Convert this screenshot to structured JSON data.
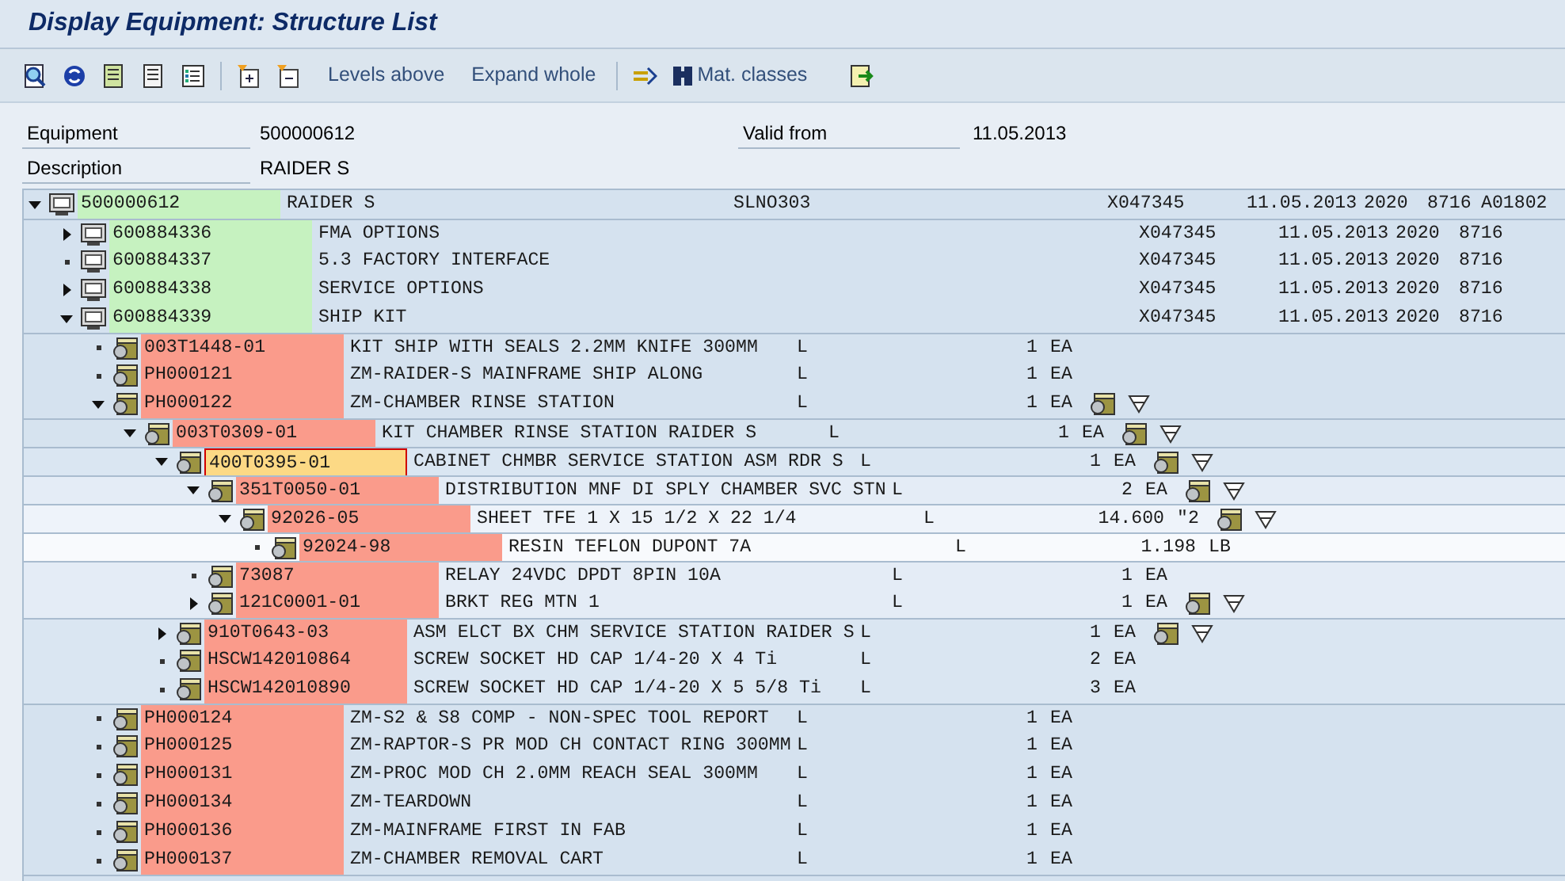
{
  "window": {
    "title": "Display Equipment: Structure List"
  },
  "toolbar": {
    "buttons": [
      "Levels above",
      "Expand whole",
      "Mat. classes"
    ]
  },
  "header": {
    "fields": [
      {
        "label": "Equipment",
        "value": "500000612"
      },
      {
        "label": "Valid from",
        "value": "11.05.2013"
      },
      {
        "label": "Description",
        "value": "RAIDER S"
      }
    ]
  },
  "tree": {
    "nodes": [
      {
        "kind": "equipment",
        "number": "500000612",
        "description": "RAIDER S",
        "expanded": true,
        "leaf": false,
        "selected": false,
        "column_3": "SLNO303",
        "column_4": "X047345",
        "column_5": "11.05.2013",
        "column_6": "2020",
        "column_7": "8716",
        "column_8": "A01802",
        "children": [
          {
            "kind": "equipment",
            "number": "600884336",
            "description": "FMA OPTIONS",
            "expanded": false,
            "leaf": false,
            "selected": false,
            "column_4": "X047345",
            "column_5": "11.05.2013",
            "column_6": "2020",
            "column_7": "8716"
          },
          {
            "kind": "equipment",
            "number": "600884337",
            "description": "5.3 FACTORY INTERFACE",
            "expanded": false,
            "leaf": true,
            "selected": false,
            "column_4": "X047345",
            "column_5": "11.05.2013",
            "column_6": "2020",
            "column_7": "8716"
          },
          {
            "kind": "equipment",
            "number": "600884338",
            "description": "SERVICE OPTIONS",
            "expanded": false,
            "leaf": false,
            "selected": false,
            "column_4": "X047345",
            "column_5": "11.05.2013",
            "column_6": "2020",
            "column_7": "8716"
          },
          {
            "kind": "equipment",
            "number": "600884339",
            "description": "SHIP KIT",
            "expanded": true,
            "leaf": false,
            "selected": false,
            "column_4": "X047345",
            "column_5": "11.05.2013",
            "column_6": "2020",
            "column_7": "8716",
            "children": [
              {
                "kind": "material",
                "number": "003T1448-01",
                "description": "KIT SHIP WITH SEALS 2.2MM KNIFE 300MM",
                "expanded": false,
                "leaf": true,
                "selected": false,
                "column_3": "L",
                "quantity": "1",
                "unit": "EA",
                "links_shown": false
              },
              {
                "kind": "material",
                "number": "PH000121",
                "description": "ZM-RAIDER-S MAINFRAME SHIP ALONG",
                "expanded": false,
                "leaf": true,
                "selected": false,
                "column_3": "L",
                "quantity": "1",
                "unit": "EA",
                "links_shown": false
              },
              {
                "kind": "material",
                "number": "PH000122",
                "description": "ZM-CHAMBER RINSE STATION",
                "expanded": true,
                "leaf": false,
                "selected": false,
                "column_3": "L",
                "quantity": "1",
                "unit": "EA",
                "links_shown": true,
                "children": [
                  {
                    "kind": "material",
                    "number": "003T0309-01",
                    "description": "KIT CHAMBER RINSE STATION RAIDER S",
                    "expanded": true,
                    "leaf": false,
                    "selected": false,
                    "column_3": "L",
                    "quantity": "1",
                    "unit": "EA",
                    "links_shown": true,
                    "children": [
                      {
                        "kind": "material",
                        "number": "400T0395-01",
                        "description": "CABINET CHMBR SERVICE STATION ASM RDR S",
                        "expanded": true,
                        "leaf": false,
                        "selected": true,
                        "column_3": "L",
                        "quantity": "1",
                        "unit": "EA",
                        "links_shown": true,
                        "children": [
                          {
                            "kind": "material",
                            "number": "351T0050-01",
                            "description": "DISTRIBUTION MNF DI SPLY CHAMBER SVC STN",
                            "expanded": true,
                            "leaf": false,
                            "selected": false,
                            "column_3": "L",
                            "quantity": "2",
                            "unit": "EA",
                            "links_shown": true,
                            "children": [
                              {
                                "kind": "material",
                                "number": "92026-05",
                                "description": "SHEET TFE 1 X 15 1/2 X 22 1/4",
                                "expanded": true,
                                "leaf": false,
                                "selected": false,
                                "column_3": "L",
                                "quantity": "14.600",
                                "unit": "\"2",
                                "links_shown": true,
                                "children": [
                                  {
                                    "kind": "material",
                                    "number": "92024-98",
                                    "description": "RESIN TEFLON DUPONT 7A",
                                    "expanded": false,
                                    "leaf": true,
                                    "selected": false,
                                    "column_3": "L",
                                    "quantity": "1.198",
                                    "unit": "LB",
                                    "links_shown": false
                                  }
                                ]
                              }
                            ]
                          },
                          {
                            "kind": "material",
                            "number": "73087",
                            "description": "RELAY 24VDC DPDT 8PIN 10A",
                            "expanded": false,
                            "leaf": true,
                            "selected": false,
                            "column_3": "L",
                            "quantity": "1",
                            "unit": "EA",
                            "links_shown": false
                          },
                          {
                            "kind": "material",
                            "number": "121C0001-01",
                            "description": "BRKT REG MTN 1",
                            "expanded": false,
                            "leaf": false,
                            "selected": false,
                            "column_3": "L",
                            "quantity": "1",
                            "unit": "EA",
                            "links_shown": true
                          }
                        ]
                      },
                      {
                        "kind": "material",
                        "number": "910T0643-03",
                        "description": "ASM ELCT BX CHM SERVICE STATION RAIDER S",
                        "expanded": false,
                        "leaf": false,
                        "selected": false,
                        "column_3": "L",
                        "quantity": "1",
                        "unit": "EA",
                        "links_shown": true
                      },
                      {
                        "kind": "material",
                        "number": "HSCW142010864",
                        "description": "SCREW SOCKET HD CAP 1/4-20 X 4 Ti",
                        "expanded": false,
                        "leaf": true,
                        "selected": false,
                        "column_3": "L",
                        "quantity": "2",
                        "unit": "EA",
                        "links_shown": false
                      },
                      {
                        "kind": "material",
                        "number": "HSCW142010890",
                        "description": "SCREW SOCKET HD CAP 1/4-20 X 5 5/8 Ti",
                        "expanded": false,
                        "leaf": true,
                        "selected": false,
                        "column_3": "L",
                        "quantity": "3",
                        "unit": "EA",
                        "links_shown": false
                      }
                    ]
                  }
                ]
              },
              {
                "kind": "material",
                "number": "PH000124",
                "description": "ZM-S2 & S8 COMP - NON-SPEC TOOL REPORT",
                "expanded": false,
                "leaf": true,
                "selected": false,
                "column_3": "L",
                "quantity": "1",
                "unit": "EA",
                "links_shown": false
              },
              {
                "kind": "material",
                "number": "PH000125",
                "description": "ZM-RAPTOR-S PR MOD CH CONTACT RING 300MM",
                "expanded": false,
                "leaf": true,
                "selected": false,
                "column_3": "L",
                "quantity": "1",
                "unit": "EA",
                "links_shown": false
              },
              {
                "kind": "material",
                "number": "PH000131",
                "description": "ZM-PROC MOD CH 2.0MM REACH SEAL 300MM",
                "expanded": false,
                "leaf": true,
                "selected": false,
                "column_3": "L",
                "quantity": "1",
                "unit": "EA",
                "links_shown": false
              },
              {
                "kind": "material",
                "number": "PH000134",
                "description": "ZM-TEARDOWN",
                "expanded": false,
                "leaf": true,
                "selected": false,
                "column_3": "L",
                "quantity": "1",
                "unit": "EA",
                "links_shown": false
              },
              {
                "kind": "material",
                "number": "PH000136",
                "description": "ZM-MAINFRAME FIRST IN FAB",
                "expanded": false,
                "leaf": true,
                "selected": false,
                "column_3": "L",
                "quantity": "1",
                "unit": "EA",
                "links_shown": false
              },
              {
                "kind": "material",
                "number": "PH000137",
                "description": "ZM-CHAMBER REMOVAL CART",
                "expanded": false,
                "leaf": true,
                "selected": false,
                "column_3": "L",
                "quantity": "1",
                "unit": "EA",
                "links_shown": false
              }
            ]
          }
        ]
      }
    ]
  }
}
